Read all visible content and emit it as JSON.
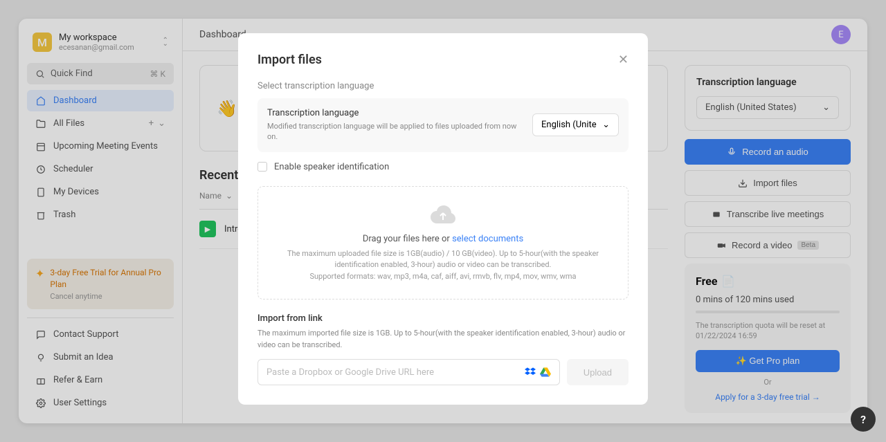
{
  "workspace": {
    "avatar": "M",
    "name": "My workspace",
    "email": "ecesanan@gmail.com"
  },
  "quickFind": {
    "label": "Quick Find",
    "shortcut": "⌘   K"
  },
  "nav": {
    "dashboard": "Dashboard",
    "allFiles": "All Files",
    "upcoming": "Upcoming Meeting Events",
    "scheduler": "Scheduler",
    "devices": "My Devices",
    "trash": "Trash"
  },
  "trial": {
    "title": "3-day Free Trial for Annual Pro Plan",
    "sub": "Cancel anytime"
  },
  "bottomNav": {
    "support": "Contact Support",
    "idea": "Submit an Idea",
    "refer": "Refer & Earn",
    "settings": "User Settings"
  },
  "topbar": {
    "breadcrumb": "Dashboard",
    "avatar": "E"
  },
  "recent": {
    "title": "Recent",
    "nameCol": "Name",
    "file1": "Intro"
  },
  "rightPanel": {
    "langTitle": "Transcription language",
    "langValue": "English (United States)",
    "recordAudio": "Record an audio",
    "importFiles": "Import files",
    "transcribe": "Transcribe live meetings",
    "recordVideo": "Record a video",
    "beta": "Beta"
  },
  "plan": {
    "name": "Free",
    "usage": "0 mins of 120 mins used",
    "note": "The transcription quota will be reset at 01/22/2024 16:59",
    "getPro": "✨ Get Pro plan",
    "or": "Or",
    "apply": "Apply for a 3-day free trial →"
  },
  "modal": {
    "title": "Import files",
    "selectLang": "Select transcription language",
    "langTitle": "Transcription language",
    "langDesc": "Modified transcription language will be applied to files uploaded from now on.",
    "langValue": "English (United …",
    "speaker": "Enable speaker identification",
    "dragText": "Drag your files here or ",
    "selectDocs": "select documents",
    "dropDesc1": "The maximum uploaded file size is 1GB(audio) / 10 GB(video). Up to 5-hour(with the speaker identification enabled, 3-hour) audio or video can be transcribed.",
    "dropDesc2": "Supported formats: wav, mp3, m4a, caf, aiff, avi, rmvb, flv, mp4, mov, wmv, wma",
    "importLinkTitle": "Import from link",
    "importLinkDesc": "The maximum imported file size is 1GB. Up to 5-hour(with the speaker identification enabled, 3-hour) audio or video can be transcribed.",
    "urlPlaceholder": "Paste a Dropbox or Google Drive URL here",
    "uploadBtn": "Upload"
  }
}
